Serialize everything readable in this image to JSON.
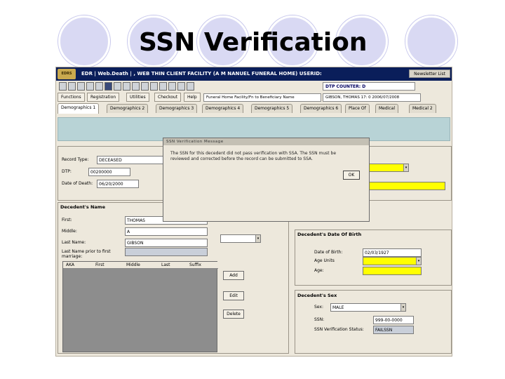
{
  "slide": {
    "title": "SSN Verification"
  },
  "app": {
    "logo_text": "EDRS",
    "title": "EDR | Web.Death | , WEB THIN CLIENT FACILITY (A M NANUEL FUNERAL HOME) USERID:",
    "title_button": "Newsletter List",
    "toolbar_icons": [
      "new-doc-icon",
      "open-icon",
      "edit-icon",
      "copy-icon",
      "paste-icon",
      "save-icon",
      "search-icon",
      "print-icon",
      "form-icon",
      "sign-icon",
      "attach-icon",
      "report-icon",
      "help-icon"
    ],
    "dtp_counter": "DTP COUNTER: D",
    "menu": [
      "Functions",
      "Registration",
      "Utilities",
      "Checkout",
      "Help"
    ],
    "combo_a": "Funeral Home Facility/Fn to Beneficiary Name",
    "combo_b": "GIBSON, THOMAS   17: 0 2006/07/2008",
    "tabs": [
      "Demographics 1",
      "Demographics 2",
      "Demographics 3",
      "Demographics 4",
      "Demographics 5",
      "Demographics 6",
      "Place Of",
      "Medical",
      "Medical 2"
    ],
    "record_type_label": "Record Type:",
    "record_type_value": "DECEASED",
    "dtp_label": "DTP:",
    "dtp_value": "00200000",
    "date_of_death_label": "Date of Death:",
    "date_of_death_value": "06/20/2000",
    "decedent_name": {
      "header": "Decedent's Name",
      "first_label": "First:",
      "first_value": "THOMAS",
      "middle_label": "Middle:",
      "middle_value": "A",
      "last_label": "Last Name:",
      "last_value": "GIBSON",
      "last_prior_label": "Last Name prior to first marriage:",
      "last_prior_value": ""
    },
    "aka_columns": [
      "AKA",
      "First",
      "Middle",
      "Last",
      "Suffix"
    ],
    "buttons": {
      "add": "Add",
      "edit": "Edit",
      "delete": "Delete"
    },
    "date_of_birth": {
      "header": "Decedent's Date Of Birth",
      "dob_label": "Date of Birth:",
      "dob_value": "02/03/1927",
      "age_units_label": "Age Units",
      "age_units_value": "",
      "age_label": "Age:",
      "age_value": ""
    },
    "sex": {
      "header": "Decedent's Sex",
      "sex_label": "Sex:",
      "sex_value": "MALE",
      "ssn_label": "SSN:",
      "ssn_value": "999-00-0000",
      "ssn_status_label": "SSN Verification Status:",
      "ssn_status_value": "FAILSSN"
    },
    "dialog": {
      "title": "SSN Verification Message",
      "message": "The SSN for this decedent did not pass verification with SSA. The SSN must be reviewed and corrected before the record can be submitted to SSA.",
      "ok": "OK"
    }
  },
  "colors": {
    "slide_circle": "#d9d9f3",
    "titlebar": "#0a1e5a",
    "panel": "#ede8dc",
    "banner": "#b8d3d6",
    "required_field": "#ffff00",
    "readonly_field": "#c9cfd9"
  }
}
